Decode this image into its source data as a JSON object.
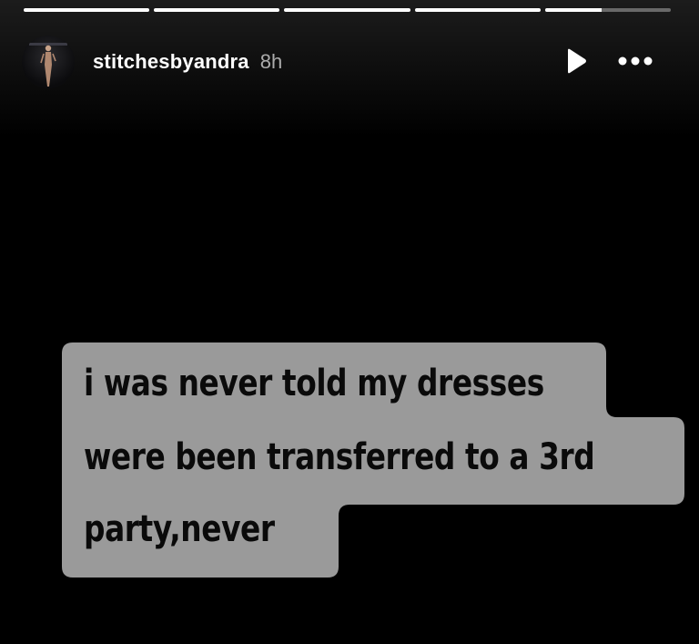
{
  "story": {
    "progress_segments": [
      1,
      1,
      1,
      1,
      0.45
    ],
    "username": "stitchesbyandra",
    "time_ago": "8h",
    "play_icon": "play-icon",
    "more_icon": "more-options-icon"
  },
  "caption": {
    "lines": [
      "i was never told my dresses",
      "were been transferred to a 3rd",
      "party,never"
    ],
    "background": "#9a9a9a"
  }
}
